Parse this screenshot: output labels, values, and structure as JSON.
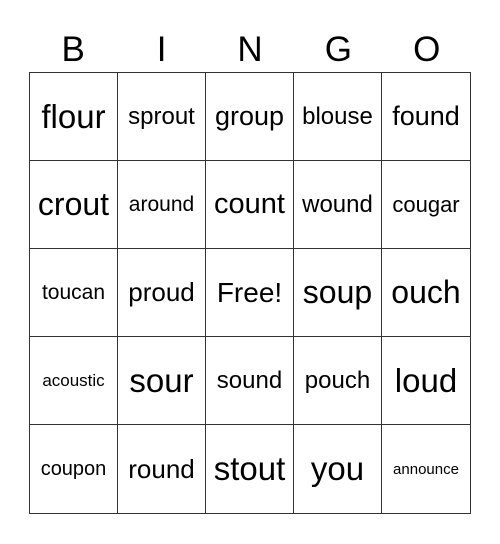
{
  "header": [
    "B",
    "I",
    "N",
    "G",
    "O"
  ],
  "cells": [
    {
      "word": "flour",
      "size": 33
    },
    {
      "word": "sprout",
      "size": 24
    },
    {
      "word": "group",
      "size": 27
    },
    {
      "word": "blouse",
      "size": 24
    },
    {
      "word": "found",
      "size": 27
    },
    {
      "word": "crout",
      "size": 32
    },
    {
      "word": "around",
      "size": 21
    },
    {
      "word": "count",
      "size": 29
    },
    {
      "word": "wound",
      "size": 24
    },
    {
      "word": "cougar",
      "size": 22
    },
    {
      "word": "toucan",
      "size": 21
    },
    {
      "word": "proud",
      "size": 26
    },
    {
      "word": "Free!",
      "size": 28
    },
    {
      "word": "soup",
      "size": 32
    },
    {
      "word": "ouch",
      "size": 32
    },
    {
      "word": "acoustic",
      "size": 17
    },
    {
      "word": "sour",
      "size": 33
    },
    {
      "word": "sound",
      "size": 24
    },
    {
      "word": "pouch",
      "size": 24
    },
    {
      "word": "loud",
      "size": 33
    },
    {
      "word": "coupon",
      "size": 20
    },
    {
      "word": "round",
      "size": 26
    },
    {
      "word": "stout",
      "size": 33
    },
    {
      "word": "you",
      "size": 33
    },
    {
      "word": "announce",
      "size": 15
    }
  ]
}
